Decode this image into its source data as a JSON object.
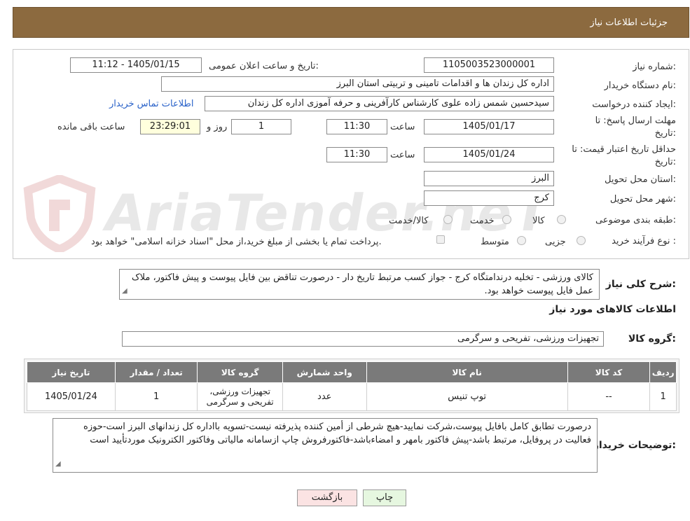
{
  "header": {
    "title": "جزئیات اطلاعات نیاز"
  },
  "form": {
    "need_number_label": "شماره نیاز:",
    "need_number": "1105003523000001",
    "announce_label": "تاریخ و ساعت اعلان عمومی:",
    "announce_value": "1405/01/15 - 11:12",
    "buyer_org_label": "نام دستگاه خریدار:",
    "buyer_org": "اداره کل زندان ها و اقدامات تامینی و تربیتی استان البرز",
    "creator_label": "ایجاد کننده درخواست:",
    "creator": "سیدحسین شمس زاده علوی کارشناس کارآفرینی و حرفه آموزی اداره کل زندان",
    "contact_link": "اطلاعات تماس خریدار",
    "deadline_label_1": "مهلت ارسال پاسخ: تا",
    "deadline_label_2": "تاریخ:",
    "deadline_date": "1405/01/17",
    "time_label": "ساعت",
    "deadline_time": "11:30",
    "days_value": "1",
    "days_label": "روز و",
    "remaining_time": "23:29:01",
    "remaining_label": "ساعت باقی مانده",
    "validity_label_1": "حداقل تاریخ اعتبار قیمت: تا",
    "validity_label_2": "تاریخ:",
    "validity_date": "1405/01/24",
    "validity_time": "11:30",
    "province_label": "استان محل تحویل:",
    "province": "البرز",
    "city_label": "شهر محل تحویل:",
    "city": "کرج",
    "category_label": "طبقه بندی موضوعی:",
    "category_options": [
      "کالا",
      "خدمت",
      "کالا/خدمت"
    ],
    "process_label": "نوع فرآیند خرید :",
    "process_options": [
      "جزیی",
      "متوسط"
    ],
    "payment_note": "پرداخت تمام یا بخشی از مبلغ خرید،از محل \"اسناد خزانه اسلامی\" خواهد بود."
  },
  "watermark": {
    "text": "AriaTender.neT"
  },
  "summary": {
    "label": "شرح کلی نیاز:",
    "text": "کالای ورزشی - تخلیه درندامتگاه کرج - جواز کسب مرتبط تاریخ دار - درصورت تناقض بین فایل پیوست و پیش فاکتور، ملاک عمل فایل پیوست خواهد بود."
  },
  "goods_section": {
    "title": "اطلاعات کالاهای مورد نیاز"
  },
  "goods_group": {
    "label": "گروه کالا:",
    "value": "تجهیزات ورزشی، تفریحی و سرگرمی"
  },
  "table": {
    "headers": [
      "ردیف",
      "کد کالا",
      "نام کالا",
      "واحد شمارش",
      "گروه کالا",
      "تعداد / مقدار",
      "تاریخ نیاز"
    ],
    "rows": [
      [
        "1",
        "--",
        "توپ تنیس",
        "عدد",
        "تجهیزات ورزشی، تفریحی و سرگرمی",
        "1",
        "1405/01/24"
      ]
    ]
  },
  "buyer_notes": {
    "label": "توضیحات خریدار:",
    "text": "درصورت تطابق کامل بافایل پیوست،شرکت نمایید-هیچ شرطی از أمین کننده پذیرفته نیست-تسویه بااداره کل زندانهای البرز است-حوزه فعالیت در پروفایل، مرتبط باشد-پیش فاکتور بامهر و امضاءباشد-فاکتورفروش چاپ ازسامانه مالیاتی وفاکتور الکترونیک موردتأیید است"
  },
  "buttons": {
    "print": "چاپ",
    "back": "بازگشت"
  },
  "colors": {
    "header_bg": "#8c6a3f",
    "table_header_bg": "#7a7a7a",
    "back_btn_bg": "#fbe3e3",
    "print_btn_bg": "#e6f7e0",
    "link": "#2a62c9"
  }
}
